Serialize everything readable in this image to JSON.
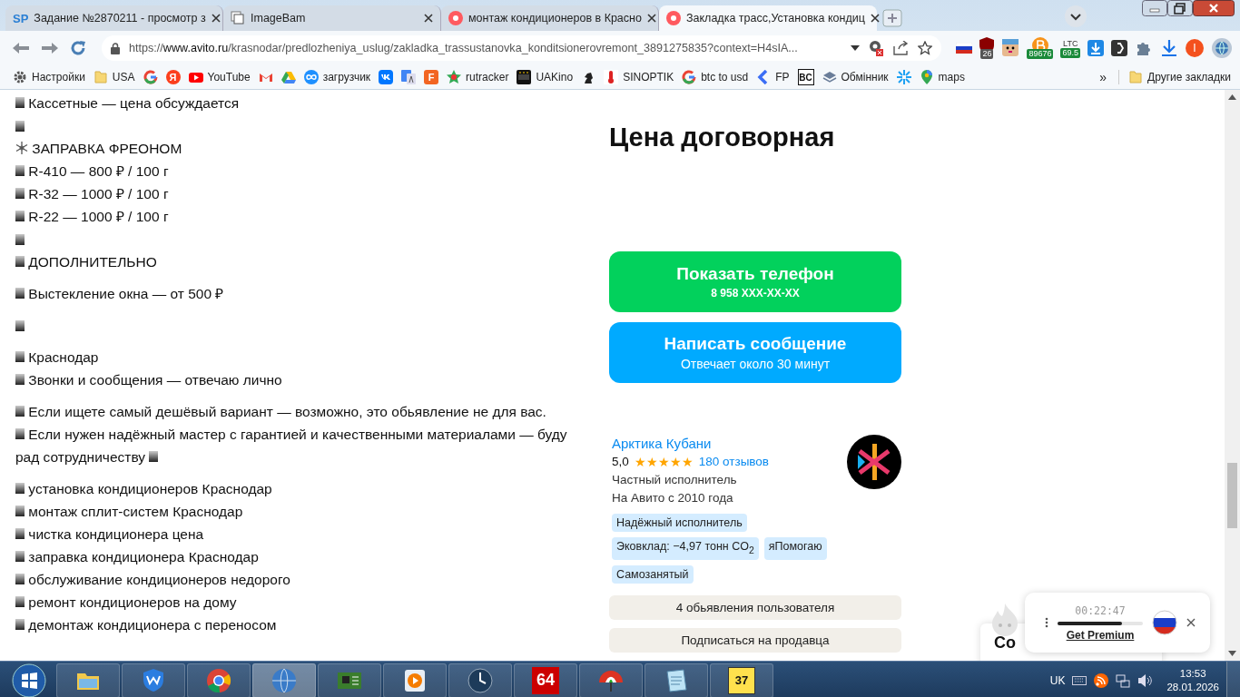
{
  "tabs": [
    {
      "title": "Задание №2870211 - просмотр з",
      "kind": "sp",
      "logo_text": "SP",
      "selected": false
    },
    {
      "title": "ImageBam",
      "kind": "page",
      "selected": false
    },
    {
      "title": "монтаж кондиционеров в Красно",
      "kind": "avito",
      "selected": false
    },
    {
      "title": "Закладка трасс,Установка кондиц",
      "kind": "avito",
      "selected": true
    }
  ],
  "address_bar": {
    "scheme": "https://",
    "host": "www.avito.ru",
    "path": "/krasnodar/predlozheniya_uslug/zakladka_trassustanovka_konditsionerovremont_3891275835?context=H4sIA..."
  },
  "extensions": [
    {
      "kind": "flag"
    },
    {
      "kind": "shield",
      "badge": "26"
    },
    {
      "kind": "face"
    },
    {
      "kind": "bitcoin",
      "badge": "89676"
    },
    {
      "kind": "ltc",
      "label": "LTC",
      "badge": "69.5"
    },
    {
      "kind": "download-box"
    },
    {
      "kind": "dark-square"
    },
    {
      "kind": "puzzle"
    },
    {
      "kind": "download"
    },
    {
      "kind": "avatar",
      "letter": "I"
    },
    {
      "kind": "globe"
    }
  ],
  "bookmarks": [
    {
      "kind": "gear",
      "label": "Настройки"
    },
    {
      "kind": "folder",
      "label": "USA"
    },
    {
      "kind": "g"
    },
    {
      "kind": "ya",
      "letter": "Я"
    },
    {
      "kind": "youtube",
      "label": "YouTube"
    },
    {
      "kind": "mail"
    },
    {
      "kind": "drive"
    },
    {
      "kind": "infinity",
      "label": "загрузчик"
    },
    {
      "kind": "vk"
    },
    {
      "kind": "translate"
    },
    {
      "kind": "f",
      "letter": "F"
    },
    {
      "kind": "star",
      "label": "rutracker"
    },
    {
      "kind": "film",
      "label": "UAKino"
    },
    {
      "kind": "knight"
    },
    {
      "kind": "thermo",
      "label": "SINOPTIK"
    },
    {
      "kind": "g",
      "label": "btc to usd"
    },
    {
      "kind": "chevron",
      "label": "FP"
    },
    {
      "kind": "bc",
      "letter": "BC"
    },
    {
      "kind": "layers",
      "label": "Обмінник"
    },
    {
      "kind": "spark"
    },
    {
      "kind": "pin",
      "label": "maps"
    }
  ],
  "bookmarks_more": "»",
  "other_bookmarks": "Другие закладки",
  "description": [
    [
      {
        "kind": "square",
        "text": "Кассетные — цена обсуждается"
      },
      {
        "kind": "square"
      },
      {
        "kind": "snowflake",
        "text": "ЗАПРАВКА ФРЕОНОМ"
      },
      {
        "kind": "square",
        "text": "R-410 — 800 ₽ / 100 г"
      },
      {
        "kind": "square",
        "text": "R-32 — 1000 ₽ / 100 г"
      },
      {
        "kind": "square",
        "text": "R-22 — 1000 ₽ / 100 г"
      },
      {
        "kind": "square"
      },
      {
        "kind": "square",
        "text": "ДОПОЛНИТЕЛЬНО"
      }
    ],
    [
      {
        "kind": "square",
        "text": "Выстекление окна — от 500 ₽"
      }
    ],
    [
      {
        "kind": "square"
      }
    ],
    [
      {
        "kind": "square",
        "text": "Краснодар"
      },
      {
        "kind": "square",
        "text": "Звонки и сообщения — отвечаю лично"
      }
    ],
    [
      {
        "kind": "square",
        "text": "Если ищете самый дешёвый вариант — возможно, это обьявление не для вас."
      },
      {
        "kind": "square_trailing",
        "text": "Если нужен надёжный мастер с гарантией и качественными материалами — буду рад сотрудничеству"
      }
    ],
    [
      {
        "kind": "square",
        "text": "установка кондиционеров Краснодар"
      },
      {
        "kind": "square",
        "text": "монтаж сплит-систем Краснодар"
      },
      {
        "kind": "square",
        "text": "чистка кондиционера цена"
      },
      {
        "kind": "square",
        "text": "заправка кондиционера Краснодар"
      },
      {
        "kind": "square",
        "text": "обслуживание кондиционеров недорого"
      },
      {
        "kind": "square",
        "text": "ремонт кондиционеров на дому"
      },
      {
        "kind": "square",
        "text": "демонтаж кондиционера с переносом"
      }
    ]
  ],
  "price": "Цена договорная",
  "contact_buttons": [
    {
      "kind": "phone",
      "title": "Показать телефон",
      "subtitle": "8 958 XXX-XX-XX"
    },
    {
      "kind": "message",
      "title": "Написать сообщение",
      "subtitle": "Отвечает около 30 минут"
    }
  ],
  "seller": {
    "name": "Арктика Кубани",
    "rating": "5,0",
    "stars": 5,
    "reviews": "180 отзывов",
    "type": "Частный исполнитель",
    "since": "На Авито с 2010 года",
    "badges": [
      [
        "Надёжный исполнитель"
      ],
      [
        "Эковклад: −4,97 тонн CO$_{2}$",
        "яПомогаю"
      ],
      [
        "Самозанятый"
      ]
    ]
  },
  "seller_buttons": [
    "4 обьявления пользователя",
    "Подписаться на продавца"
  ],
  "hidden_card_title": "Со",
  "player": {
    "time": "00:22:47",
    "level": 0.75,
    "link": "Get Premium"
  },
  "taskbar": {
    "apps": [
      {
        "kind": "folder",
        "selected": false
      },
      {
        "kind": "shield",
        "selected": false
      },
      {
        "kind": "chrome",
        "selected": false
      },
      {
        "kind": "globe",
        "selected": true
      },
      {
        "kind": "board",
        "selected": false
      },
      {
        "kind": "media",
        "selected": false
      },
      {
        "kind": "clock",
        "selected": false
      },
      {
        "kind": "aida",
        "label": "64",
        "selected": false
      },
      {
        "kind": "umbrella",
        "selected": false
      },
      {
        "kind": "notepad",
        "selected": false
      },
      {
        "kind": "calendar",
        "label": "37",
        "selected": false
      }
    ],
    "language": "UK",
    "time": "13:53",
    "date": "28.01.2026"
  }
}
